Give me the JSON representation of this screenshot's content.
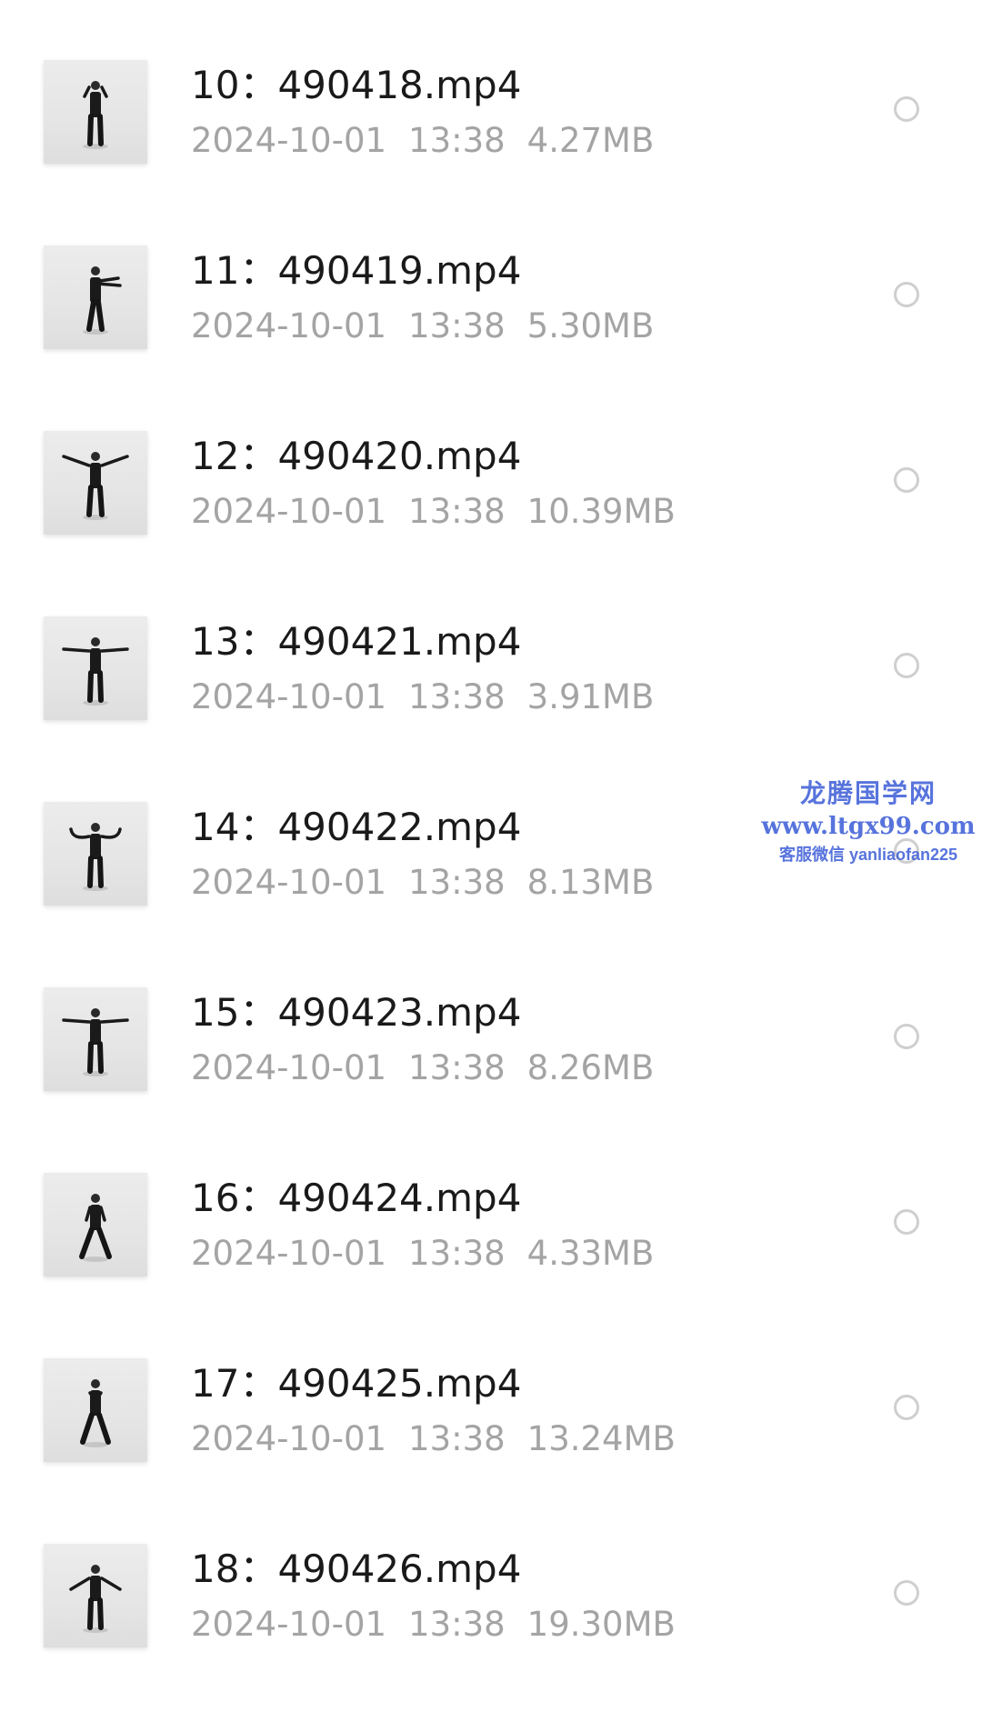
{
  "files": [
    {
      "name": "10：490418.mp4",
      "date": "2024-10-01",
      "time": "13:38",
      "size": "4.27MB",
      "pose": "hands-front",
      "selected": false
    },
    {
      "name": "11：490419.mp4",
      "date": "2024-10-01",
      "time": "13:38",
      "size": "5.30MB",
      "pose": "side-arms-forward",
      "selected": false
    },
    {
      "name": "12：490420.mp4",
      "date": "2024-10-01",
      "time": "13:38",
      "size": "10.39MB",
      "pose": "arms-raised-out",
      "selected": false
    },
    {
      "name": "13：490421.mp4",
      "date": "2024-10-01",
      "time": "13:38",
      "size": "3.91MB",
      "pose": "arms-out",
      "selected": false
    },
    {
      "name": "14：490422.mp4",
      "date": "2024-10-01",
      "time": "13:38",
      "size": "8.13MB",
      "pose": "arms-curved-down",
      "selected": false
    },
    {
      "name": "15：490423.mp4",
      "date": "2024-10-01",
      "time": "13:38",
      "size": "8.26MB",
      "pose": "arms-out",
      "selected": false
    },
    {
      "name": "16：490424.mp4",
      "date": "2024-10-01",
      "time": "13:38",
      "size": "4.33MB",
      "pose": "wide-stance",
      "selected": false
    },
    {
      "name": "17：490425.mp4",
      "date": "2024-10-01",
      "time": "13:38",
      "size": "13.24MB",
      "pose": "wide-stance-hands-chest",
      "selected": false
    },
    {
      "name": "18：490426.mp4",
      "date": "2024-10-01",
      "time": "13:38",
      "size": "19.30MB",
      "pose": "arms-low",
      "selected": false
    }
  ],
  "watermark": {
    "title": "龙腾国学网",
    "url": "www.ltgx99.com",
    "contact": "客服微信 yanliaofan225"
  },
  "colors": {
    "name_text": "#1a1a1a",
    "meta_text": "#a4a4a4",
    "radio_border": "#cfcfcf",
    "watermark": "#3a5bd6"
  }
}
